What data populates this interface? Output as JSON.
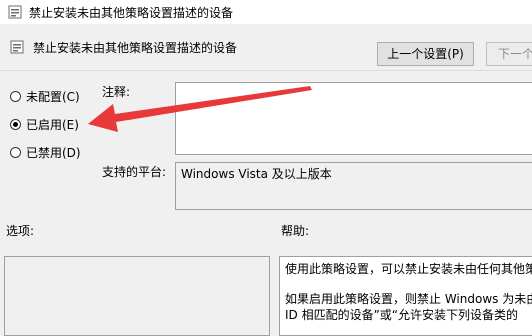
{
  "window": {
    "title": "禁止安装未由其他策略设置描述的设备"
  },
  "header": {
    "policy_title": "禁止安装未由其他策略设置描述的设备",
    "prev_button": "上一个设置(P)",
    "next_button": "下一个"
  },
  "state": {
    "options": [
      {
        "label": "未配置(C)",
        "selected": false
      },
      {
        "label": "已启用(E)",
        "selected": true
      },
      {
        "label": "已禁用(D)",
        "selected": false
      }
    ]
  },
  "comment": {
    "label": "注释:",
    "value": ""
  },
  "platform": {
    "label": "支持的平台:",
    "value": "Windows Vista 及以上版本"
  },
  "options_section": {
    "label": "选项:"
  },
  "help_section": {
    "label": "帮助:",
    "line1": "使用此策略设置，可以禁止安装未由任何其他策",
    "line2": "如果启用此策略设置，则禁止 Windows 为未由",
    "line3": "ID 相匹配的设备”或“允许安装下列设备类的"
  },
  "annotation": {
    "arrow_color": "#e8393a"
  }
}
